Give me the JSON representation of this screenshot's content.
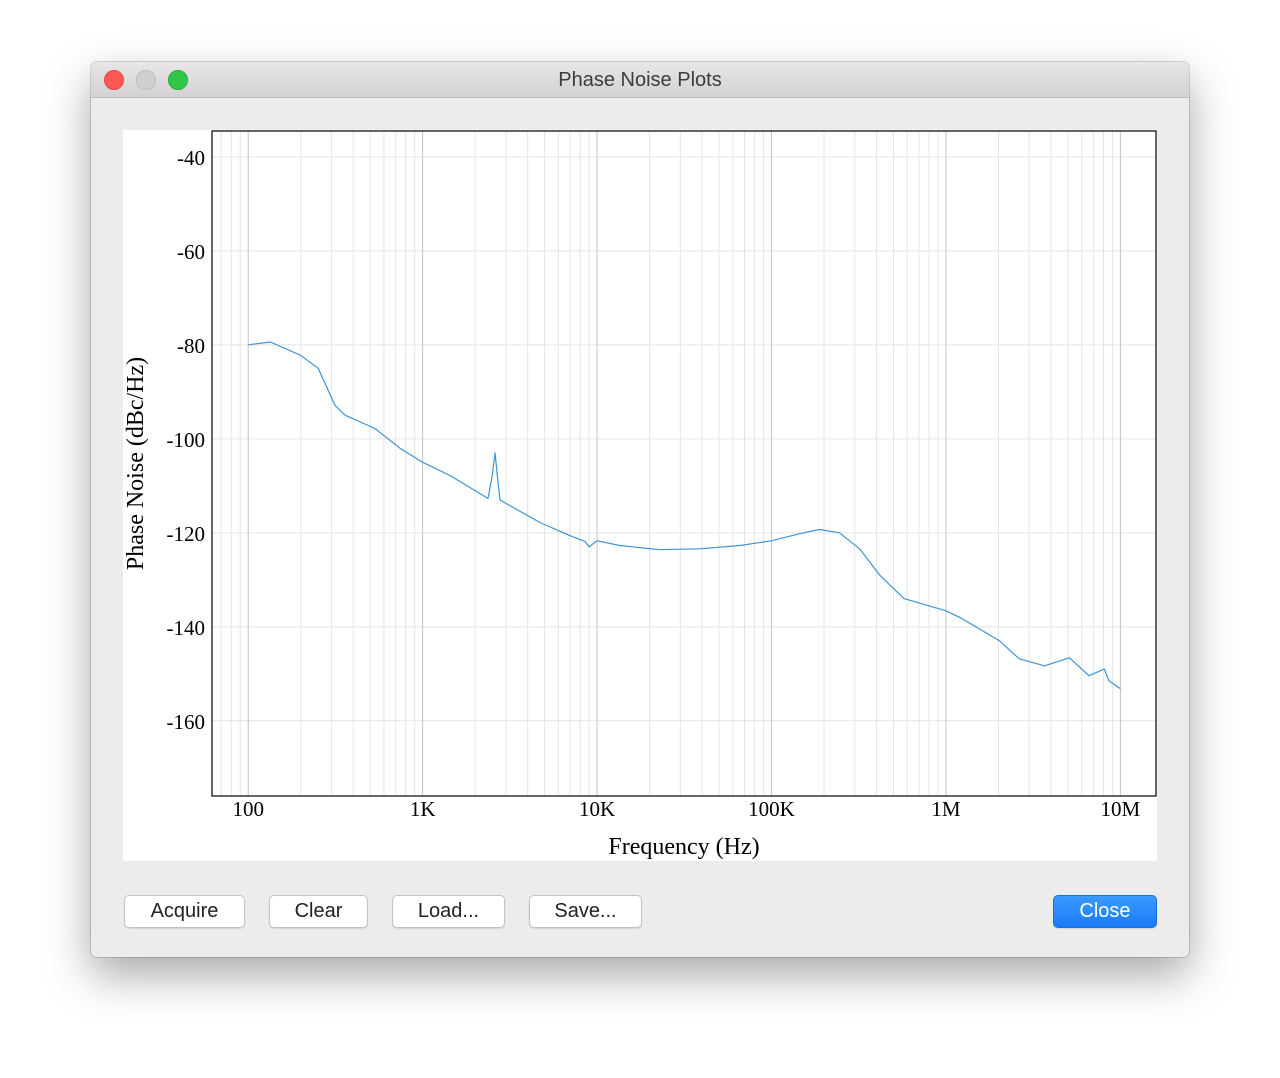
{
  "window": {
    "title": "Phase Noise Plots"
  },
  "buttons": {
    "acquire": "Acquire",
    "clear": "Clear",
    "load": "Load...",
    "save": "Save...",
    "close": "Close"
  },
  "colors": {
    "series": "#3d94d6",
    "close_button": "#1a7cf5",
    "grid": "#e4e4e4",
    "major_grid": "#c4c4c4"
  },
  "chart_data": {
    "type": "line",
    "xlabel": "Frequency (Hz)",
    "ylabel": "Phase Noise (dBc/Hz)",
    "xscale": "log",
    "xlim": [
      62,
      16000000
    ],
    "ylim": [
      -176,
      -34.5
    ],
    "xticks": [
      {
        "v": 100,
        "label": "100"
      },
      {
        "v": 1000,
        "label": "1K"
      },
      {
        "v": 10000,
        "label": "10K"
      },
      {
        "v": 100000,
        "label": "100K"
      },
      {
        "v": 1000000,
        "label": "1M"
      },
      {
        "v": 10000000,
        "label": "10M"
      }
    ],
    "yticks": [
      -40,
      -60,
      -80,
      -100,
      -120,
      -140,
      -160
    ],
    "grid": true,
    "series": [
      {
        "x": [
          100,
          134,
          199,
          252,
          315,
          360,
          533,
          741,
          1000,
          1435,
          1995,
          2370,
          2500,
          2600,
          2700,
          2775,
          3160,
          4700,
          6980,
          8500,
          9000,
          10000,
          13500,
          22900,
          38900,
          66000,
          100000,
          144000,
          188000,
          245000,
          320000,
          417000,
          575000,
          1000000,
          1200000,
          2030000,
          2630000,
          3670000,
          5100000,
          6600000,
          8100000,
          8600000,
          10000000
        ],
        "y": [
          -80,
          -79.4,
          -82.2,
          -85,
          -92.9,
          -95,
          -97.8,
          -102,
          -105,
          -107.8,
          -111,
          -112.7,
          -108,
          -103,
          -109,
          -113,
          -114.2,
          -117.8,
          -120.6,
          -121.8,
          -123,
          -121.7,
          -122.7,
          -123.6,
          -123.4,
          -122.7,
          -121.7,
          -120.2,
          -119.3,
          -120,
          -123.4,
          -129,
          -134,
          -136.6,
          -138,
          -143,
          -146.8,
          -148.3,
          -146.6,
          -150.4,
          -149,
          -151.5,
          -153.2
        ]
      }
    ]
  }
}
